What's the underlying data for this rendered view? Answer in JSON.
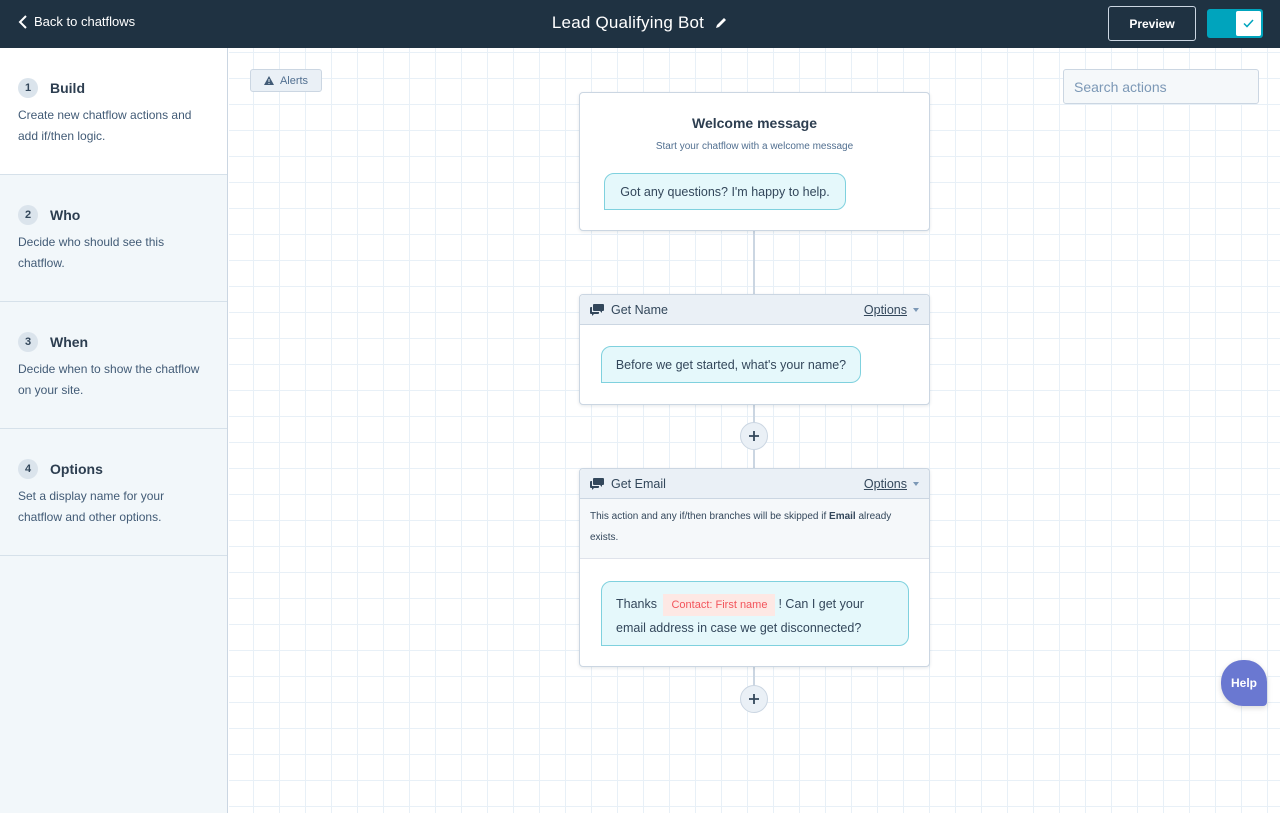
{
  "topbar": {
    "back_label": "Back to chatflows",
    "back_icon": "chevron-left-icon",
    "title": "Lead Qualifying Bot",
    "edit_icon": "pencil-icon",
    "preview_label": "Preview",
    "toggle": {
      "state": "on",
      "icon": "check-icon"
    }
  },
  "sidebar": {
    "steps": [
      {
        "number": "1",
        "title": "Build",
        "description": "Create new chatflow actions and add if/then logic.",
        "active": true
      },
      {
        "number": "2",
        "title": "Who",
        "description": "Decide who should see this chatflow.",
        "active": false
      },
      {
        "number": "3",
        "title": "When",
        "description": "Decide when to show the chatflow on your site.",
        "active": false
      },
      {
        "number": "4",
        "title": "Options",
        "description": "Set a display name for your chatflow and other options.",
        "active": false
      }
    ]
  },
  "canvas": {
    "alerts_label": "Alerts",
    "alerts_icon": "warning-icon",
    "search": {
      "placeholder": "Search actions",
      "value": "",
      "icon": "search-icon"
    },
    "welcome": {
      "title": "Welcome message",
      "subtitle": "Start your chatflow with a welcome message",
      "message": "Got any questions? I'm happy to help."
    },
    "actions": [
      {
        "name": "Get Name",
        "icon": "chat-bubbles-icon",
        "options_label": "Options",
        "message": "Before we get started, what's your name?"
      },
      {
        "name": "Get Email",
        "icon": "chat-bubbles-icon",
        "options_label": "Options",
        "notice_before": "This action and any if/then branches will be skipped if ",
        "notice_bold": "Email",
        "notice_after": " already exists.",
        "message_before": "Thanks",
        "token": "Contact: First name",
        "message_after": "! Can I get your email address in case we get disconnected?"
      }
    ],
    "add_icon": "plus-icon",
    "help_label": "Help"
  },
  "colors": {
    "topbar": "#1f3242",
    "accent": "#00a4bd",
    "bubble_bg": "#e5f8fb",
    "bubble_border": "#7fd1de",
    "token_text": "#f2545b",
    "help": "#6a78d1"
  }
}
